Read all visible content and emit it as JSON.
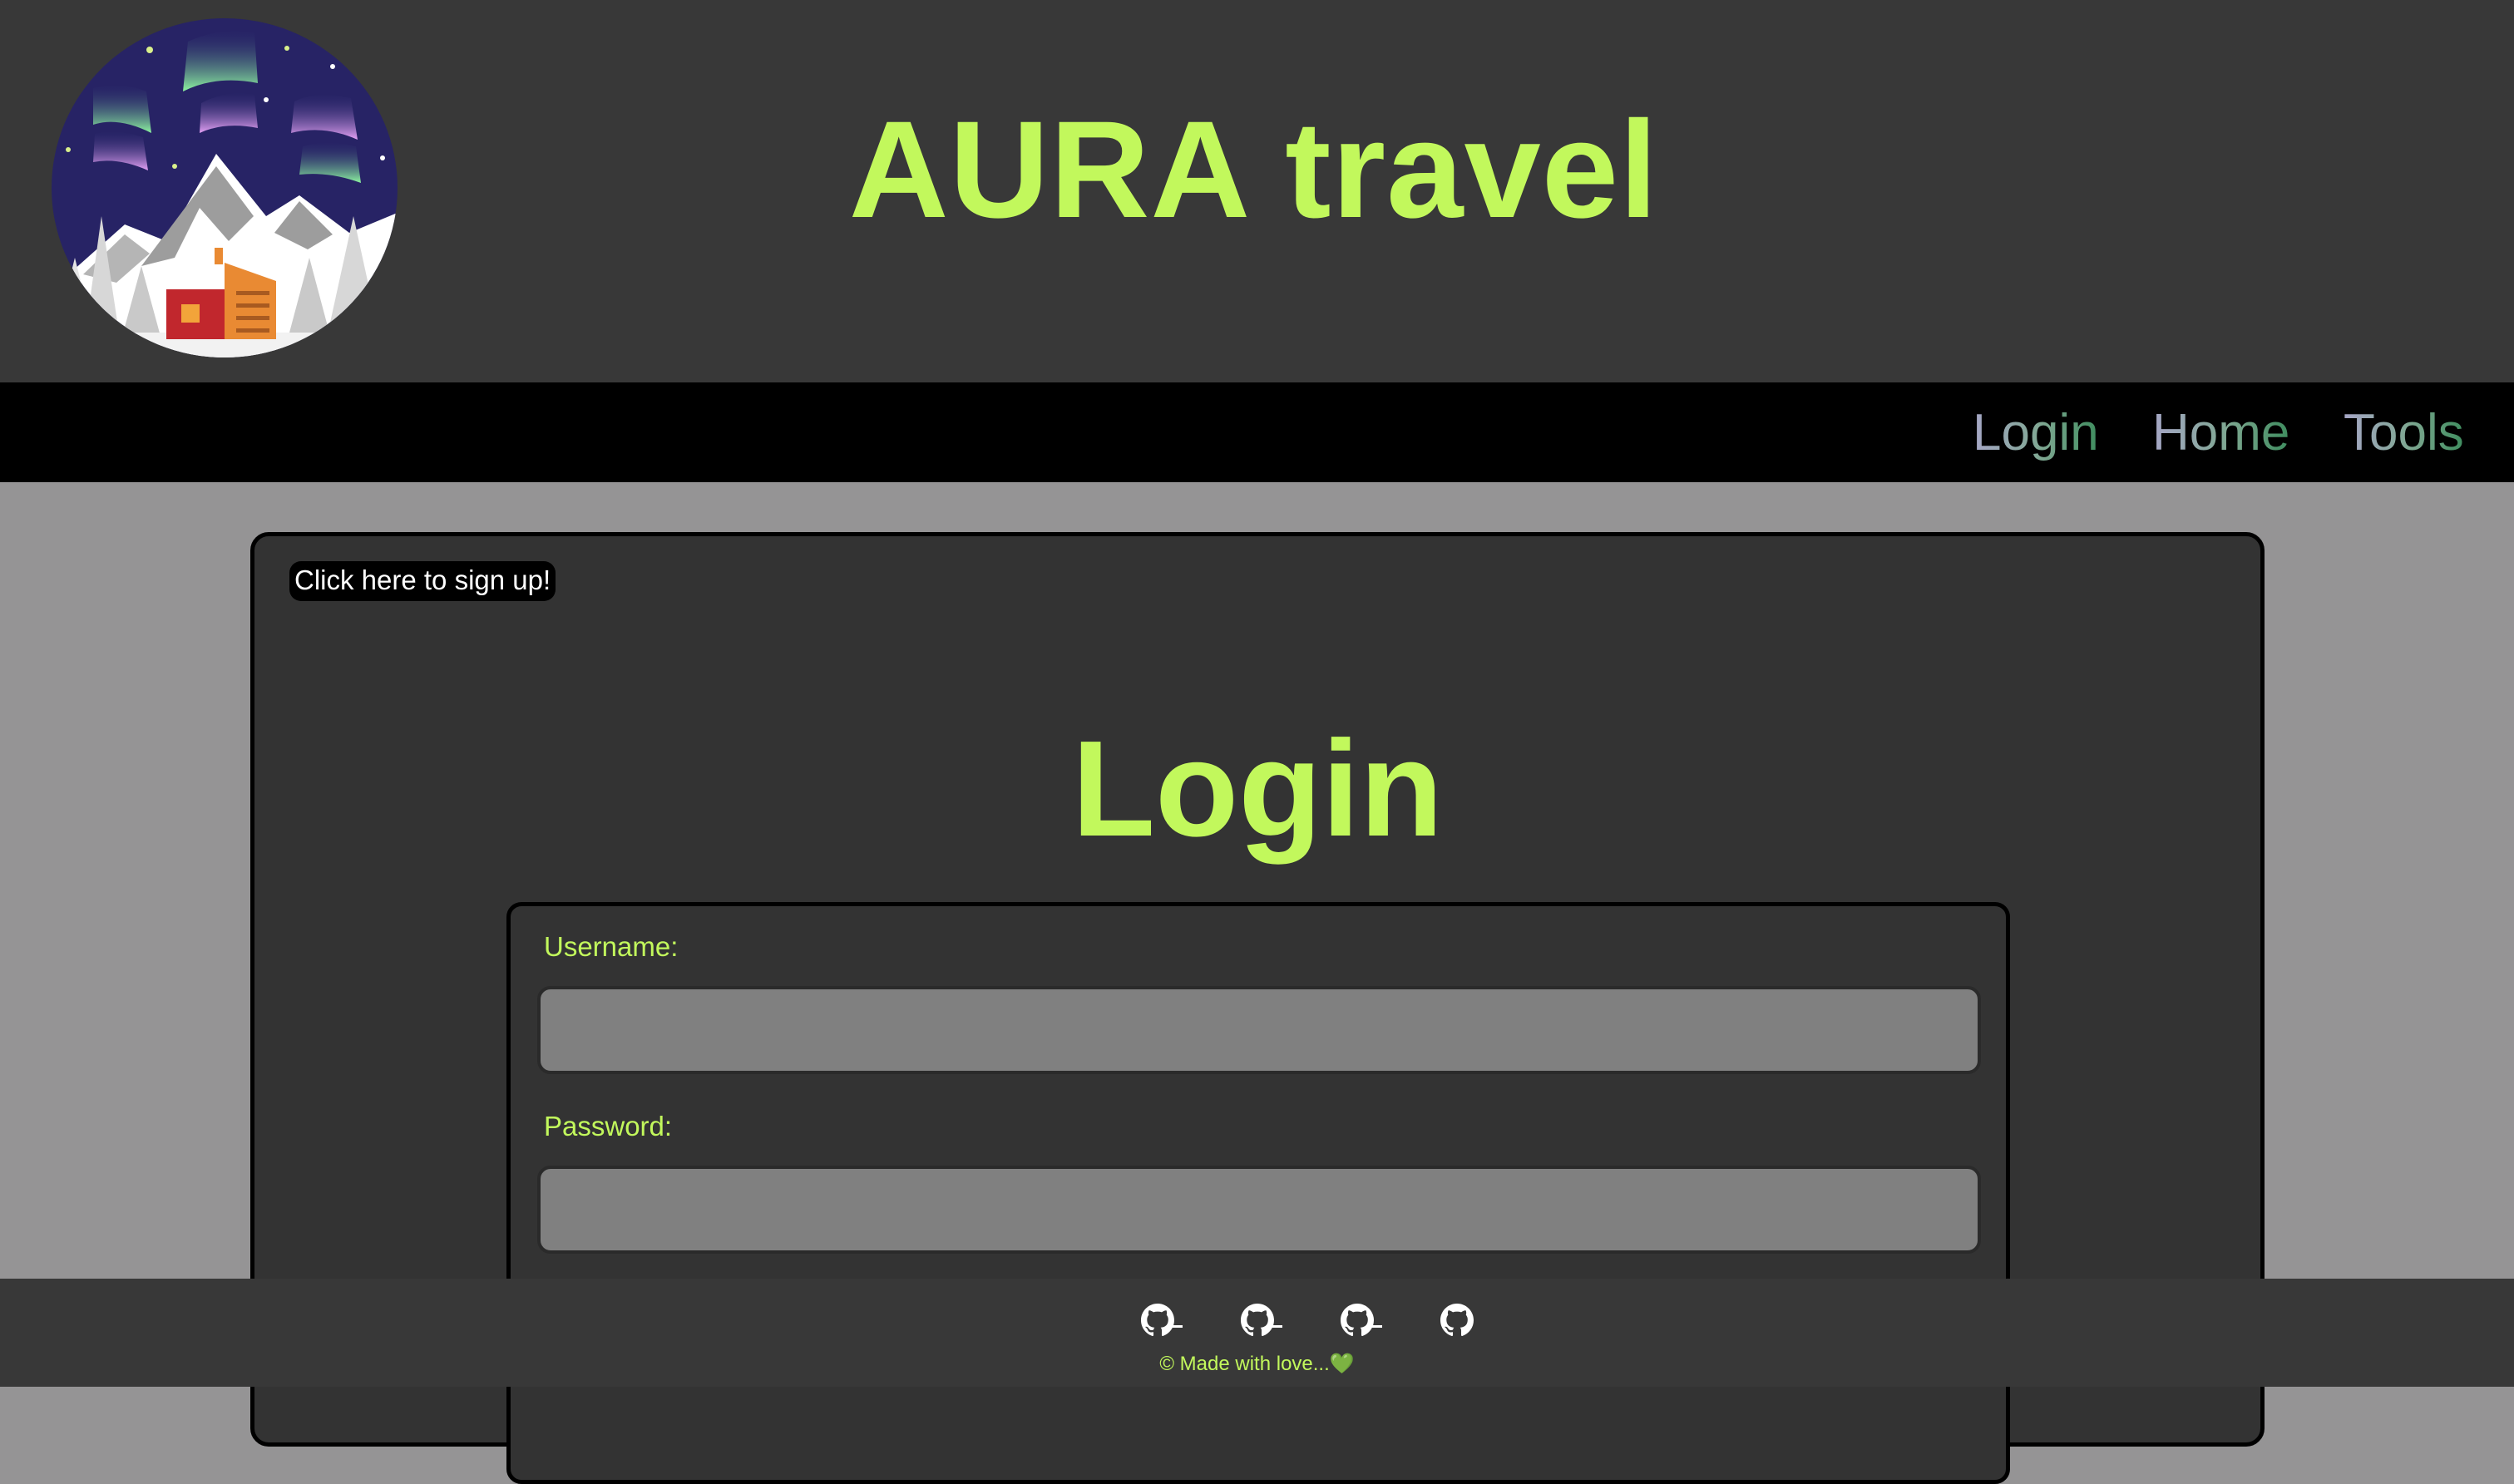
{
  "header": {
    "title": "AURA travel",
    "logo_icon": "aurora-mountain-cabin-logo"
  },
  "nav": {
    "items": [
      {
        "label": "Login"
      },
      {
        "label": "Home"
      },
      {
        "label": "Tools"
      }
    ]
  },
  "main": {
    "signup_label": "Click here to sign up!",
    "heading": "Login",
    "form": {
      "username_label": "Username:",
      "username_value": "",
      "password_label": "Password:",
      "password_value": ""
    }
  },
  "footer": {
    "links": [
      {
        "icon": "github-icon"
      },
      {
        "icon": "github-icon"
      },
      {
        "icon": "github-icon"
      },
      {
        "icon": "github-icon"
      }
    ],
    "copyright": "© Made with love...💚"
  },
  "colors": {
    "accent": "#c2f85c",
    "header_bg": "#383838",
    "nav_bg": "#000000",
    "page_bg": "#959495",
    "card_bg": "#333333",
    "input_bg": "#808080"
  }
}
